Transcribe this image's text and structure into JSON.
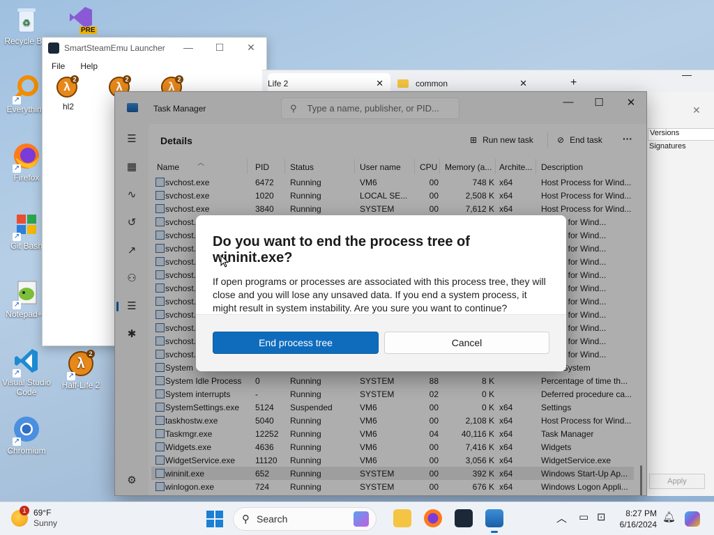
{
  "desktop": {
    "icons": [
      {
        "label": "Recycle Bin",
        "icon": "recycle-bin-icon"
      },
      {
        "label": "Everything",
        "icon": "everything-search-icon"
      },
      {
        "label": "Firefox",
        "icon": "firefox-icon"
      },
      {
        "label": "Git Bash",
        "icon": "git-bash-icon"
      },
      {
        "label": "Notepad++",
        "icon": "notepad-plus-plus-icon"
      },
      {
        "label": "Visual Studio Code",
        "icon": "vscode-icon"
      },
      {
        "label": "Chromium",
        "icon": "chromium-icon"
      },
      {
        "label": "Half-Life 2",
        "icon": "half-life-2-icon"
      },
      {
        "label": "PRE",
        "icon": "visual-studio-preview-icon"
      }
    ]
  },
  "sse_window": {
    "title": "SmartSteamEmu Launcher",
    "menu": [
      "File",
      "Help"
    ],
    "games": [
      {
        "label": "hl2"
      },
      {
        "label": ""
      },
      {
        "label": ""
      }
    ]
  },
  "background_tabs": [
    {
      "label": "Life 2"
    },
    {
      "label": "common"
    }
  ],
  "explorer_bg": {
    "items": [
      "Versions",
      "Signatures",
      "Apply"
    ]
  },
  "task_manager": {
    "title": "Task Manager",
    "search_placeholder": "Type a name, publisher, or PID...",
    "section": "Details",
    "run_new_task": "Run new task",
    "end_task": "End task",
    "more": "···",
    "columns": [
      "Name",
      "PID",
      "Status",
      "User name",
      "CPU",
      "Memory (a...",
      "Archite...",
      "Description"
    ],
    "rows": [
      {
        "name": "svchost.exe",
        "pid": "6472",
        "status": "Running",
        "user": "VM6",
        "cpu": "00",
        "mem": "748 K",
        "arch": "x64",
        "desc": "Host Process for Wind..."
      },
      {
        "name": "svchost.exe",
        "pid": "1020",
        "status": "Running",
        "user": "LOCAL SE...",
        "cpu": "00",
        "mem": "2,508 K",
        "arch": "x64",
        "desc": "Host Process for Wind..."
      },
      {
        "name": "svchost.exe",
        "pid": "3840",
        "status": "Running",
        "user": "SYSTEM",
        "cpu": "00",
        "mem": "7,612 K",
        "arch": "x64",
        "desc": "Host Process for Wind..."
      },
      {
        "name": "svchost.exe",
        "pid": "",
        "status": "",
        "user": "",
        "cpu": "",
        "mem": "",
        "arch": "",
        "desc": "rocess for Wind..."
      },
      {
        "name": "svchost.",
        "pid": "",
        "status": "",
        "user": "",
        "cpu": "",
        "mem": "",
        "arch": "",
        "desc": "rocess for Wind..."
      },
      {
        "name": "svchost.",
        "pid": "",
        "status": "",
        "user": "",
        "cpu": "",
        "mem": "",
        "arch": "",
        "desc": "rocess for Wind..."
      },
      {
        "name": "svchost.",
        "pid": "",
        "status": "",
        "user": "",
        "cpu": "",
        "mem": "",
        "arch": "",
        "desc": "rocess for Wind..."
      },
      {
        "name": "svchost.",
        "pid": "",
        "status": "",
        "user": "",
        "cpu": "",
        "mem": "",
        "arch": "",
        "desc": "rocess for Wind..."
      },
      {
        "name": "svchost.",
        "pid": "",
        "status": "",
        "user": "",
        "cpu": "",
        "mem": "",
        "arch": "",
        "desc": "rocess for Wind..."
      },
      {
        "name": "svchost.",
        "pid": "",
        "status": "",
        "user": "",
        "cpu": "",
        "mem": "",
        "arch": "",
        "desc": "rocess for Wind..."
      },
      {
        "name": "svchost.",
        "pid": "",
        "status": "",
        "user": "",
        "cpu": "",
        "mem": "",
        "arch": "",
        "desc": "rocess for Wind..."
      },
      {
        "name": "svchost.",
        "pid": "",
        "status": "",
        "user": "",
        "cpu": "",
        "mem": "",
        "arch": "",
        "desc": "rocess for Wind..."
      },
      {
        "name": "svchost.",
        "pid": "",
        "status": "",
        "user": "",
        "cpu": "",
        "mem": "",
        "arch": "",
        "desc": "rocess for Wind..."
      },
      {
        "name": "svchost.",
        "pid": "",
        "status": "",
        "user": "",
        "cpu": "",
        "mem": "",
        "arch": "",
        "desc": "rocess for Wind..."
      },
      {
        "name": "System",
        "pid": "",
        "status": "",
        "user": "",
        "cpu": "",
        "mem": "",
        "arch": "",
        "desc": "nel & System"
      },
      {
        "name": "System Idle Process",
        "pid": "0",
        "status": "Running",
        "user": "SYSTEM",
        "cpu": "88",
        "mem": "8 K",
        "arch": "",
        "desc": "Percentage of time th..."
      },
      {
        "name": "System interrupts",
        "pid": "-",
        "status": "Running",
        "user": "SYSTEM",
        "cpu": "02",
        "mem": "0 K",
        "arch": "",
        "desc": "Deferred procedure ca..."
      },
      {
        "name": "SystemSettings.exe",
        "pid": "5124",
        "status": "Suspended",
        "user": "VM6",
        "cpu": "00",
        "mem": "0 K",
        "arch": "x64",
        "desc": "Settings"
      },
      {
        "name": "taskhostw.exe",
        "pid": "5040",
        "status": "Running",
        "user": "VM6",
        "cpu": "00",
        "mem": "2,108 K",
        "arch": "x64",
        "desc": "Host Process for Wind..."
      },
      {
        "name": "Taskmgr.exe",
        "pid": "12252",
        "status": "Running",
        "user": "VM6",
        "cpu": "04",
        "mem": "40,116 K",
        "arch": "x64",
        "desc": "Task Manager"
      },
      {
        "name": "Widgets.exe",
        "pid": "4636",
        "status": "Running",
        "user": "VM6",
        "cpu": "00",
        "mem": "7,416 K",
        "arch": "x64",
        "desc": "Widgets"
      },
      {
        "name": "WidgetService.exe",
        "pid": "11120",
        "status": "Running",
        "user": "VM6",
        "cpu": "00",
        "mem": "3,056 K",
        "arch": "x64",
        "desc": "WidgetService.exe"
      },
      {
        "name": "wininit.exe",
        "pid": "652",
        "status": "Running",
        "user": "SYSTEM",
        "cpu": "00",
        "mem": "392 K",
        "arch": "x64",
        "desc": "Windows Start-Up Ap...",
        "selected": true
      },
      {
        "name": "winlogon.exe",
        "pid": "724",
        "status": "Running",
        "user": "SYSTEM",
        "cpu": "00",
        "mem": "676 K",
        "arch": "x64",
        "desc": "Windows Logon Appli..."
      }
    ]
  },
  "dialog": {
    "title": "Do you want to end the process tree of wininit.exe?",
    "text": "If open programs or processes are associated with this process tree, they will close and you will lose any unsaved data. If you end a system process, it might result in system instability. Are you sure you want to continue?",
    "confirm": "End process tree",
    "cancel": "Cancel"
  },
  "taskbar": {
    "weather_temp": "69°F",
    "weather_cond": "Sunny",
    "weather_badge": "1",
    "search": "Search",
    "time": "8:27 PM",
    "date": "6/16/2024"
  },
  "colors": {
    "accent": "#0f6cbd",
    "desktop": "#a9c2dc"
  }
}
